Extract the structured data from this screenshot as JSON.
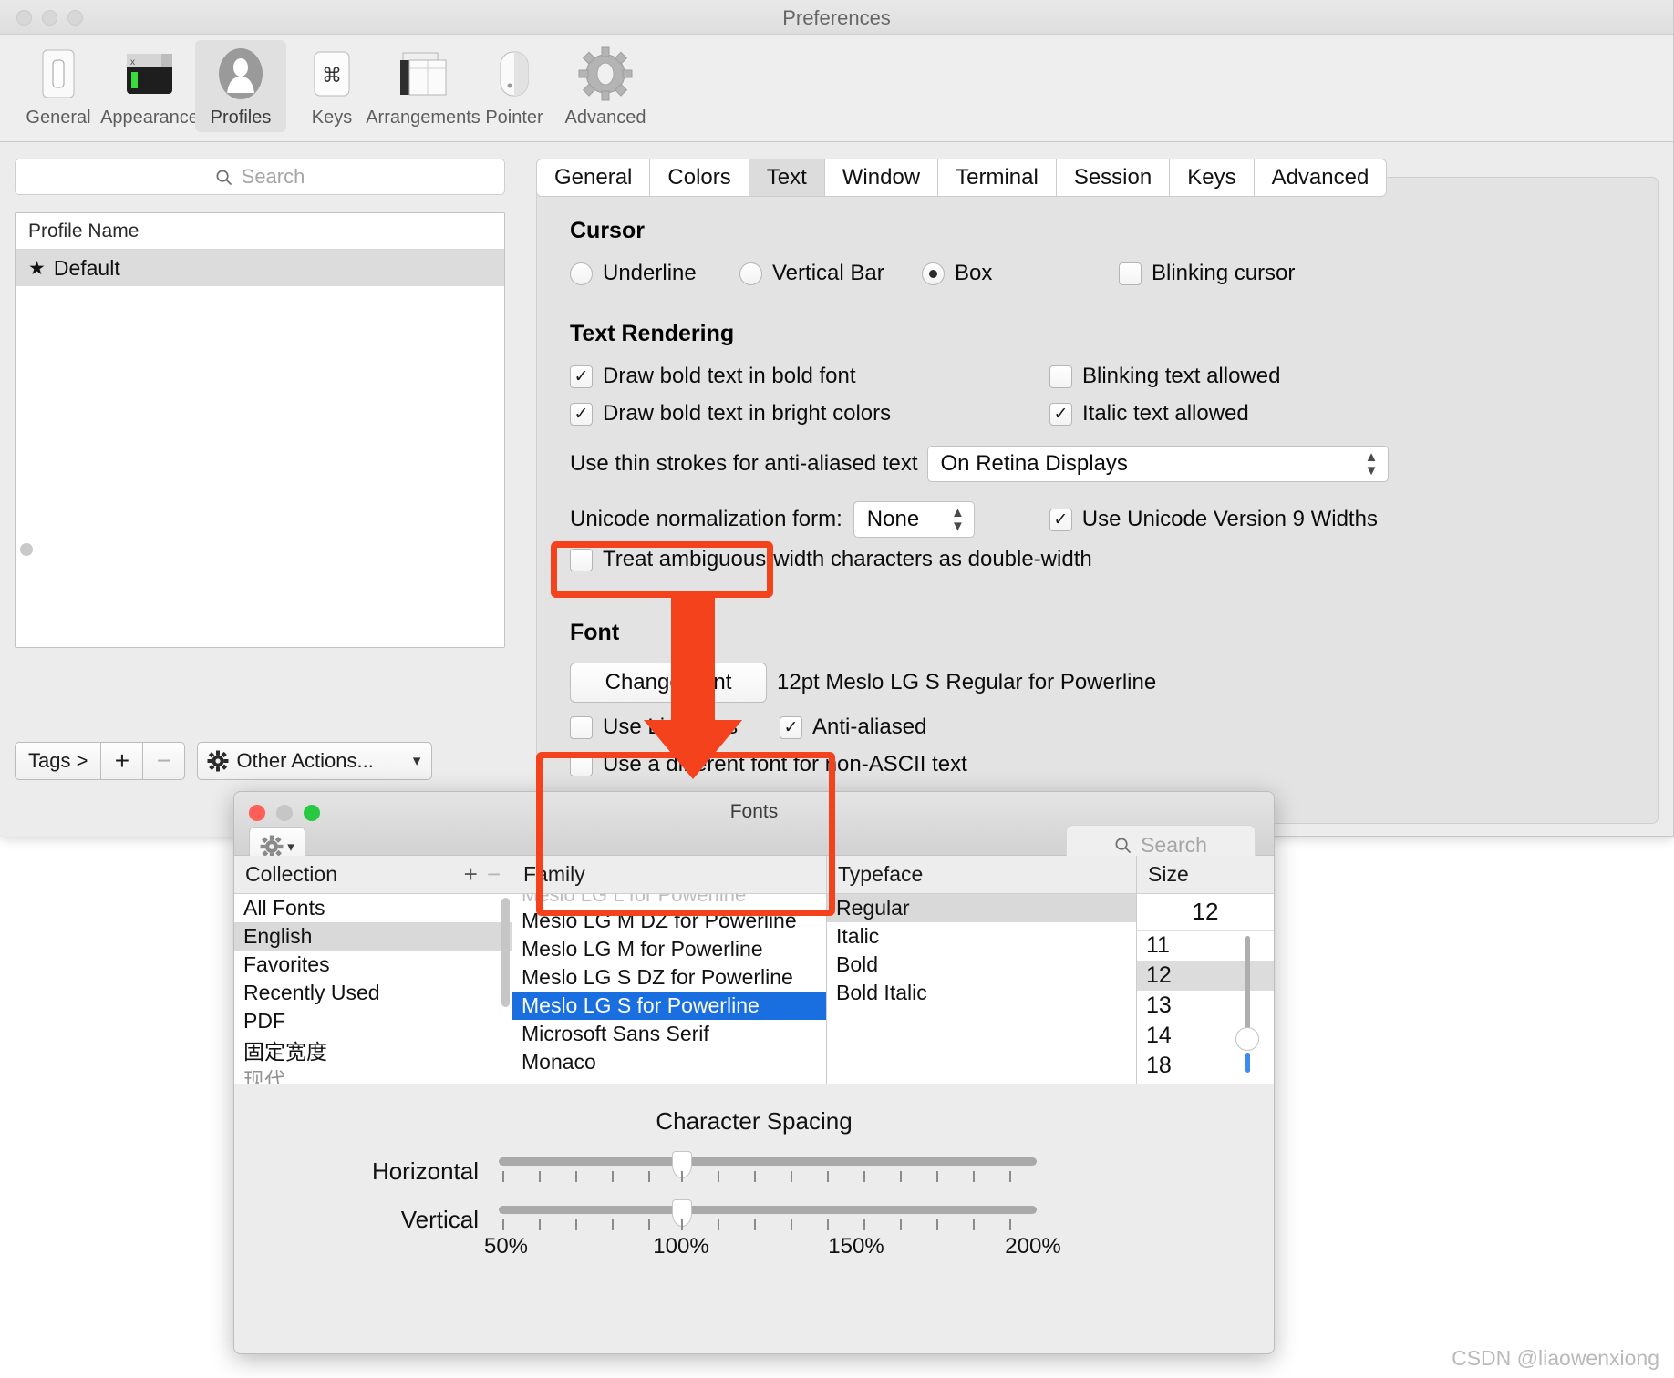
{
  "prefs_window": {
    "title": "Preferences",
    "toolbar": [
      {
        "label": "General",
        "icon": "switch-icon",
        "selected": false
      },
      {
        "label": "Appearance",
        "icon": "terminal-window-icon",
        "selected": false
      },
      {
        "label": "Profiles",
        "icon": "person-silhouette-icon",
        "selected": true
      },
      {
        "label": "Keys",
        "icon": "command-key-icon",
        "selected": false
      },
      {
        "label": "Arrangements",
        "icon": "window-panes-icon",
        "selected": false
      },
      {
        "label": "Pointer",
        "icon": "mouse-icon",
        "selected": false
      },
      {
        "label": "Advanced",
        "icon": "gear-icon",
        "selected": false
      }
    ]
  },
  "left_pane": {
    "search": {
      "placeholder": "Search",
      "value": "",
      "icon": "search-icon"
    },
    "profile_table": {
      "header": "Profile Name",
      "rows": [
        {
          "star": "★",
          "name": "Default",
          "selected": true
        }
      ]
    },
    "footer": {
      "tags_label": "Tags >",
      "add_label": "+",
      "remove_label": "−",
      "other_actions_label": "Other Actions...",
      "other_actions_icon": "gear-icon",
      "chevron_icon": "chevron-down-icon"
    }
  },
  "tabs": [
    {
      "label": "General",
      "selected": false
    },
    {
      "label": "Colors",
      "selected": false
    },
    {
      "label": "Text",
      "selected": true
    },
    {
      "label": "Window",
      "selected": false
    },
    {
      "label": "Terminal",
      "selected": false
    },
    {
      "label": "Session",
      "selected": false
    },
    {
      "label": "Keys",
      "selected": false
    },
    {
      "label": "Advanced",
      "selected": false
    }
  ],
  "text_tab": {
    "cursor": {
      "section_title": "Cursor",
      "options": [
        {
          "label": "Underline",
          "selected": false
        },
        {
          "label": "Vertical Bar",
          "selected": false
        },
        {
          "label": "Box",
          "selected": true
        }
      ],
      "blinking_cursor": {
        "label": "Blinking cursor",
        "checked": false
      }
    },
    "text_rendering": {
      "section_title": "Text Rendering",
      "draw_bold_bold_font": {
        "label": "Draw bold text in bold font",
        "checked": true
      },
      "draw_bold_bright_colors": {
        "label": "Draw bold text in bright colors",
        "checked": true
      },
      "blinking_text_allowed": {
        "label": "Blinking text allowed",
        "checked": false
      },
      "italic_text_allowed": {
        "label": "Italic text allowed",
        "checked": true
      },
      "thin_strokes_label": "Use thin strokes for anti-aliased text",
      "thin_strokes_value": "On Retina Displays",
      "unicode_norm_label": "Unicode normalization form:",
      "unicode_norm_value": "None",
      "unicode_v9": {
        "label": "Use Unicode Version 9 Widths",
        "checked": true
      },
      "ambiguous_width": {
        "label": "Treat ambiguous-width characters as double-width",
        "checked": false
      }
    },
    "font": {
      "section_title": "Font",
      "change_font_button": "Change Font",
      "current_font": "12pt Meslo LG S Regular for Powerline",
      "use_ligatures": {
        "label": "Use Ligatures",
        "checked": false
      },
      "anti_aliased": {
        "label": "Anti-aliased",
        "checked": true
      },
      "different_font_non_ascii": {
        "label": "Use a different font for non-ASCII text",
        "checked": false
      }
    }
  },
  "fonts_window": {
    "title": "Fonts",
    "gear_icon": "gear-icon",
    "gear_chevron_icon": "chevron-down-icon",
    "search": {
      "placeholder": "Search",
      "value": "",
      "icon": "search-icon"
    },
    "collection": {
      "header": "Collection",
      "add_icon": "plus-icon",
      "remove_icon": "minus-icon",
      "items": [
        {
          "label": "All Fonts",
          "selected": false
        },
        {
          "label": "English",
          "selected": true
        },
        {
          "label": "Favorites",
          "selected": false
        },
        {
          "label": "Recently Used",
          "selected": false
        },
        {
          "label": "PDF",
          "selected": false
        },
        {
          "label": "固定宽度",
          "selected": false
        },
        {
          "label": "现代",
          "selected": false
        }
      ]
    },
    "family": {
      "header": "Family",
      "items": [
        {
          "label": "Meslo LG L for Powerline",
          "selected": false,
          "clipped": true
        },
        {
          "label": "Meslo LG M DZ for Powerline",
          "selected": false
        },
        {
          "label": "Meslo LG M for Powerline",
          "selected": false
        },
        {
          "label": "Meslo LG S DZ for Powerline",
          "selected": false
        },
        {
          "label": "Meslo LG S for Powerline",
          "selected": true
        },
        {
          "label": "Microsoft Sans Serif",
          "selected": false
        },
        {
          "label": "Monaco",
          "selected": false
        }
      ]
    },
    "typeface": {
      "header": "Typeface",
      "items": [
        {
          "label": "Regular",
          "selected": true
        },
        {
          "label": "Italic",
          "selected": false
        },
        {
          "label": "Bold",
          "selected": false
        },
        {
          "label": "Bold Italic",
          "selected": false
        }
      ]
    },
    "size": {
      "header": "Size",
      "value": "12",
      "items": [
        {
          "label": "11",
          "selected": false
        },
        {
          "label": "12",
          "selected": true
        },
        {
          "label": "13",
          "selected": false
        },
        {
          "label": "14",
          "selected": false
        },
        {
          "label": "18",
          "selected": false
        }
      ]
    },
    "character_spacing": {
      "title": "Character Spacing",
      "horizontal_label": "Horizontal",
      "vertical_label": "Vertical",
      "horizontal_value": "100%",
      "vertical_value": "100%",
      "scale": [
        "50%",
        "100%",
        "150%",
        "200%"
      ]
    }
  },
  "annotations": {
    "highlight_color": "#f4421d",
    "arrow_color": "#f4421d"
  },
  "watermark": "CSDN @liaowenxiong"
}
